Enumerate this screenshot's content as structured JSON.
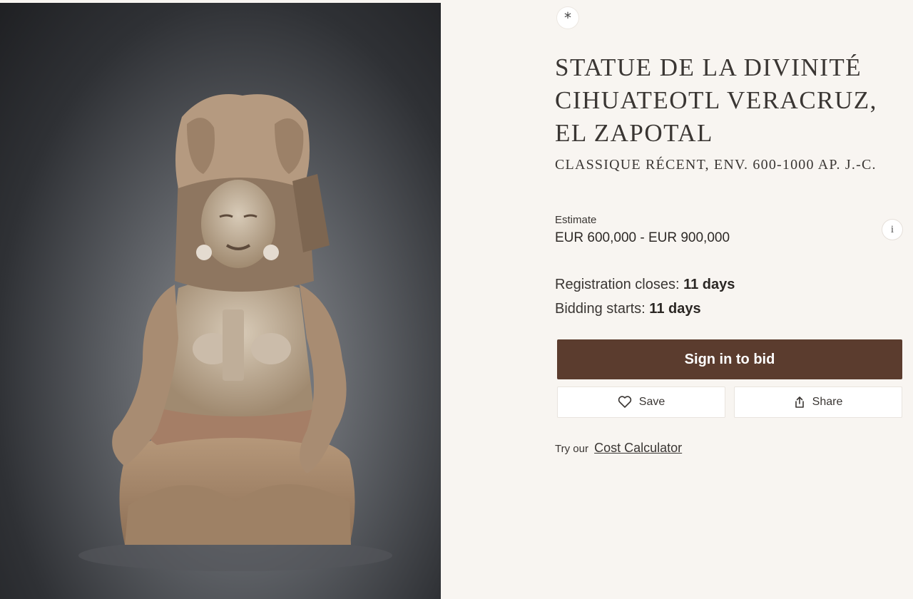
{
  "photo": {
    "alt": ""
  },
  "lot": {
    "badge_symbol": "*",
    "title": "STATUE DE LA DIVINITÉ CIHUATEOTL VERACRUZ, EL ZAPOTAL",
    "subtitle": "CLASSIQUE RÉCENT, ENV. 600-1000 AP. J.-C."
  },
  "estimate": {
    "label": "Estimate",
    "value": "EUR 600,000 - EUR 900,000",
    "info_icon": "i"
  },
  "status": {
    "registration_label": "Registration closes:",
    "registration_value": "11 days",
    "bidding_label": "Bidding starts:",
    "bidding_value": "11 days"
  },
  "actions": {
    "bid_label": "Sign in to bid",
    "save_label": "Save",
    "share_label": "Share"
  },
  "calculator": {
    "prefix": "Try our",
    "link_label": "Cost Calculator"
  },
  "colors": {
    "accent": "#5b3c2e",
    "background": "#f8f5f1",
    "text": "#3a3633"
  },
  "icons": [
    "heart-icon",
    "share-icon",
    "info-icon",
    "asterisk-icon"
  ]
}
